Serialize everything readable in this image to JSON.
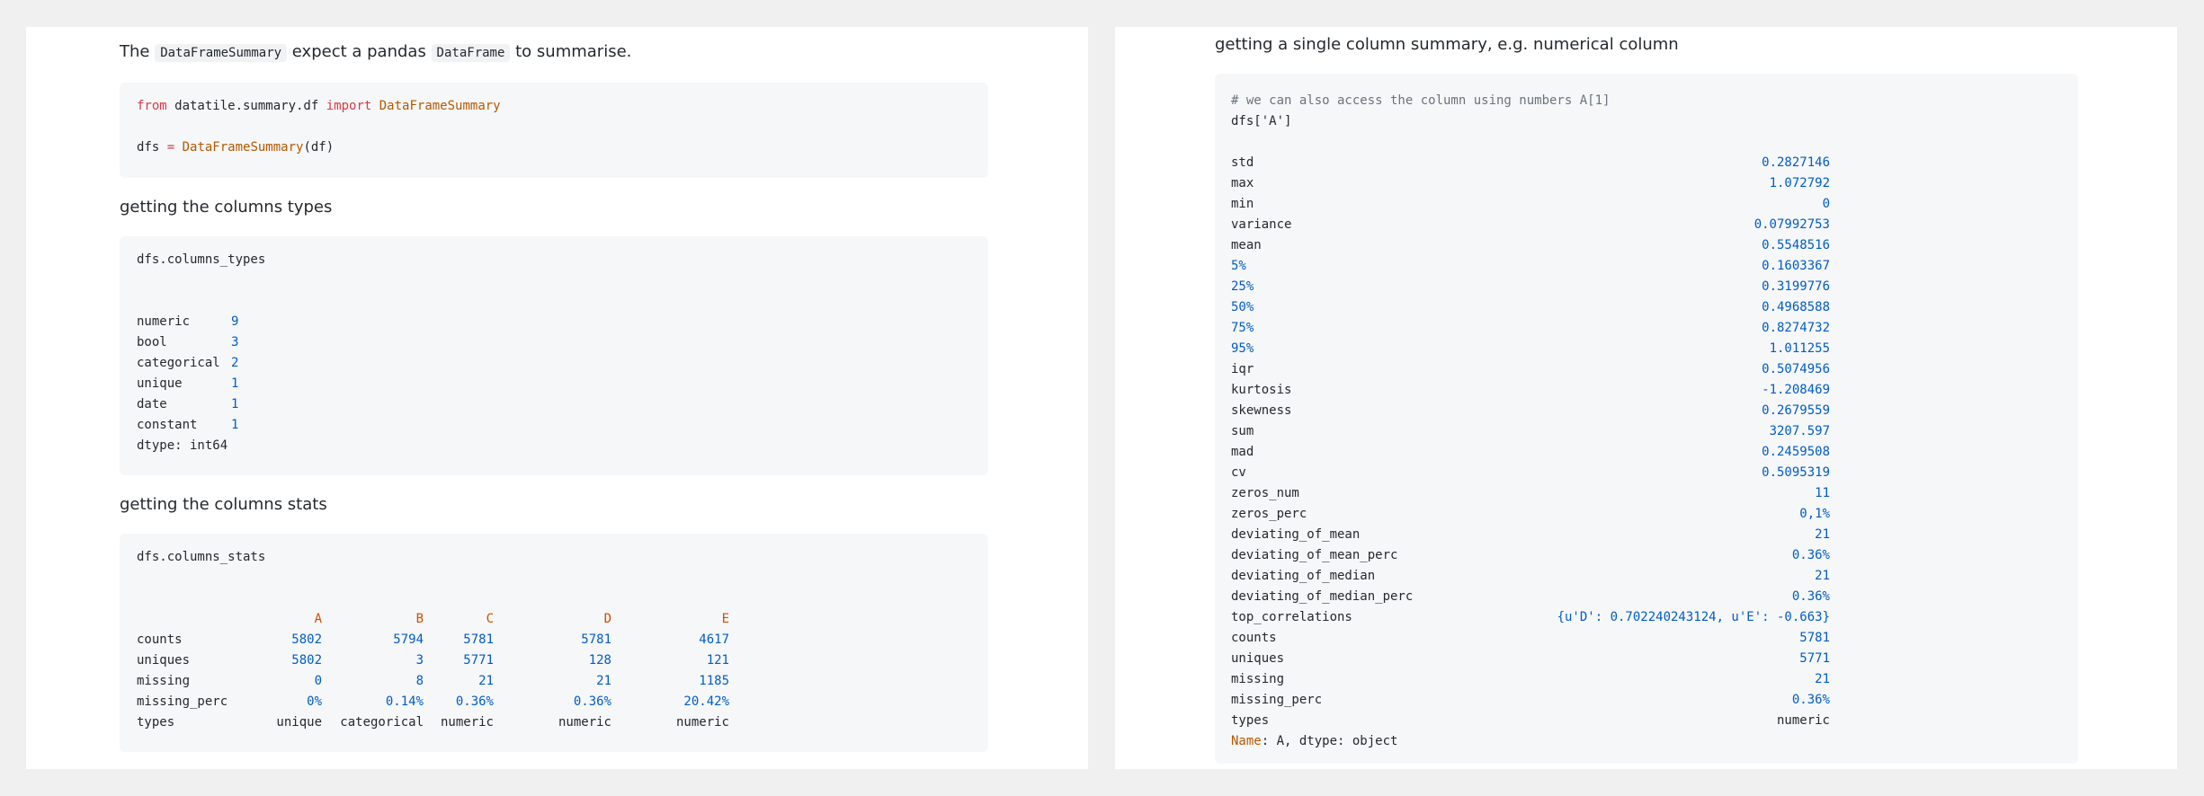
{
  "left": {
    "intro": {
      "p1": "The ",
      "code1": "DataFrameSummary",
      "p2": " expect a pandas ",
      "code2": "DataFrame",
      "p3": " to summarise."
    },
    "import_code": {
      "from_kw": "from",
      "module": " datatile.summary.df ",
      "import_kw": "import",
      "cls_name": " DataFrameSummary",
      "assign_lhs": "dfs ",
      "assign_op": "=",
      "assign_cls": " DataFrameSummary",
      "assign_arg": "(df)"
    },
    "types_heading": "getting the columns types",
    "types_code": "dfs.columns_types",
    "types_table": [
      {
        "label": "numeric",
        "value": "9"
      },
      {
        "label": "bool",
        "value": "3"
      },
      {
        "label": "categorical",
        "value": "2"
      },
      {
        "label": "unique",
        "value": "1"
      },
      {
        "label": "date",
        "value": "1"
      },
      {
        "label": "constant",
        "value": "1"
      }
    ],
    "types_dtype": "dtype: int64",
    "stats_heading": "getting the columns stats",
    "stats_code": "dfs.columns_stats",
    "stats_table": {
      "columns": [
        "A",
        "B",
        "C",
        "D",
        "E"
      ],
      "rows": [
        {
          "label": "counts",
          "values": [
            "5802",
            "5794",
            "5781",
            "5781",
            "4617"
          ]
        },
        {
          "label": "uniques",
          "values": [
            "5802",
            "3",
            "5771",
            "128",
            "121"
          ]
        },
        {
          "label": "missing",
          "values": [
            "0",
            "8",
            "21",
            "21",
            "1185"
          ]
        },
        {
          "label": "missing_perc",
          "values": [
            "0%",
            "0.14%",
            "0.36%",
            "0.36%",
            "20.42%"
          ]
        },
        {
          "label": "types",
          "values": [
            "unique",
            "categorical",
            "numeric",
            "numeric",
            "numeric"
          ]
        }
      ]
    }
  },
  "right": {
    "heading": "getting a single column summary, e.g. numerical column",
    "comment": "# we can also access the column using numbers A[1]",
    "code_line": "dfs['A']",
    "summary": [
      {
        "label": "std",
        "value": "0.2827146"
      },
      {
        "label": "max",
        "value": "1.072792"
      },
      {
        "label": "min",
        "value": "0"
      },
      {
        "label": "variance",
        "value": "0.07992753"
      },
      {
        "label": "mean",
        "value": "0.5548516"
      },
      {
        "label": "5%",
        "value": "0.1603367"
      },
      {
        "label": "25%",
        "value": "0.3199776"
      },
      {
        "label": "50%",
        "value": "0.4968588"
      },
      {
        "label": "75%",
        "value": "0.8274732"
      },
      {
        "label": "95%",
        "value": "1.011255"
      },
      {
        "label": "iqr",
        "value": "0.5074956"
      },
      {
        "label": "kurtosis",
        "value": "-1.208469"
      },
      {
        "label": "skewness",
        "value": "0.2679559"
      },
      {
        "label": "sum",
        "value": "3207.597"
      },
      {
        "label": "mad",
        "value": "0.2459508"
      },
      {
        "label": "cv",
        "value": "0.5095319"
      },
      {
        "label": "zeros_num",
        "value": "11"
      },
      {
        "label": "zeros_perc",
        "value": "0,1%"
      },
      {
        "label": "deviating_of_mean",
        "value": "21"
      },
      {
        "label": "deviating_of_mean_perc",
        "value": "0.36%"
      },
      {
        "label": "deviating_of_median",
        "value": "21"
      },
      {
        "label": "deviating_of_median_perc",
        "value": "0.36%"
      },
      {
        "label": "top_correlations",
        "value": "{u'D': 0.702240243124, u'E': -0.663}"
      },
      {
        "label": "counts",
        "value": "5781"
      },
      {
        "label": "uniques",
        "value": "5771"
      },
      {
        "label": "missing",
        "value": "21"
      },
      {
        "label": "missing_perc",
        "value": "0.36%"
      },
      {
        "label": "types",
        "value": "numeric"
      }
    ],
    "footer": {
      "name_kw": "Name",
      "rest": ": A, dtype: object"
    }
  }
}
